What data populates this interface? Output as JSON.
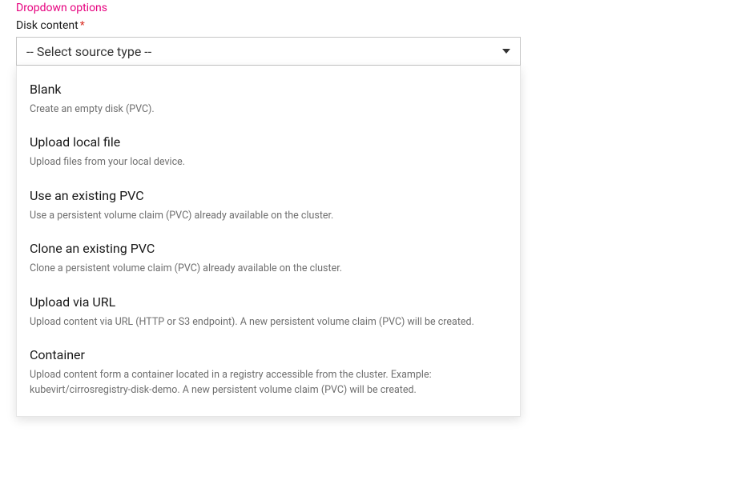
{
  "header": {
    "section_label": "Dropdown options"
  },
  "field": {
    "label": "Disk content",
    "required_marker": "*"
  },
  "select": {
    "placeholder": "-- Select source type --"
  },
  "options": [
    {
      "title": "Blank",
      "description": "Create an empty disk (PVC)."
    },
    {
      "title": "Upload local file",
      "description": "Upload files from your local device."
    },
    {
      "title": "Use an existing PVC",
      "description": "Use a persistent volume claim (PVC) already available on the cluster."
    },
    {
      "title": "Clone an existing PVC",
      "description": "Clone a persistent volume claim (PVC) already available on the cluster."
    },
    {
      "title": "Upload via URL",
      "description": "Upload content via URL (HTTP or S3 endpoint). A new persistent volume claim (PVC) will be created."
    },
    {
      "title": "Container",
      "description": " Upload content form a container located in a registry accessible from the cluster. Example: kubevirt/cirrosregistry-disk-demo. A new persistent volume claim (PVC) will be created."
    }
  ]
}
